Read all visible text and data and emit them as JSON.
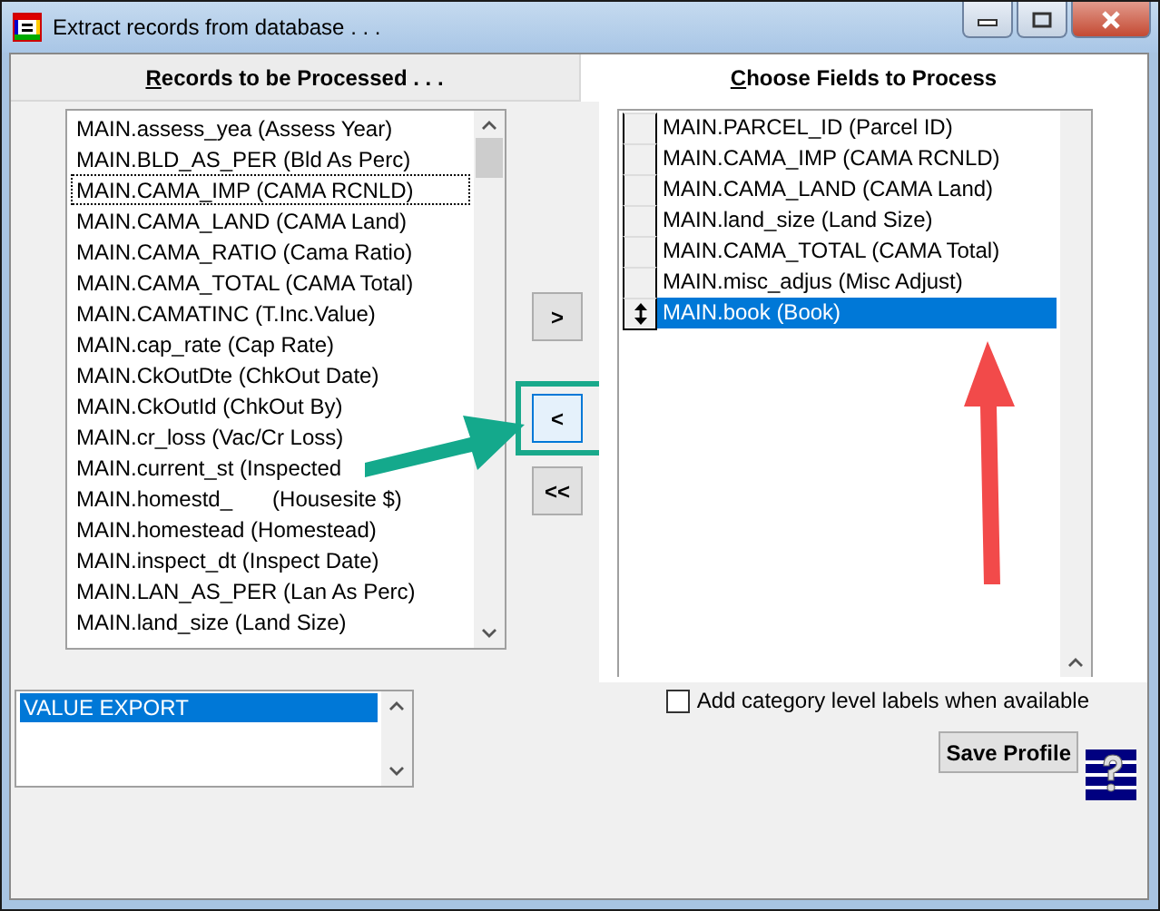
{
  "window": {
    "title": "Extract records from database . . ."
  },
  "tabs": [
    {
      "label": "Records to be Processed . . .",
      "selected": false
    },
    {
      "label": "Choose Fields to Process",
      "selected": true
    }
  ],
  "records": [
    {
      "label": "MAIN.assess_yea (Assess Year)",
      "focused": false
    },
    {
      "label": "MAIN.BLD_AS_PER (Bld As Perc)",
      "focused": false
    },
    {
      "label": "MAIN.CAMA_IMP (CAMA RCNLD)",
      "focused": true
    },
    {
      "label": "MAIN.CAMA_LAND (CAMA Land)",
      "focused": false
    },
    {
      "label": "MAIN.CAMA_RATIO (Cama Ratio)",
      "focused": false
    },
    {
      "label": "MAIN.CAMA_TOTAL (CAMA Total)",
      "focused": false
    },
    {
      "label": "MAIN.CAMATINC (T.Inc.Value)",
      "focused": false
    },
    {
      "label": "MAIN.cap_rate (Cap Rate)",
      "focused": false
    },
    {
      "label": "MAIN.CkOutDte (ChkOut Date)",
      "focused": false
    },
    {
      "label": "MAIN.CkOutId (ChkOut By)",
      "focused": false
    },
    {
      "label": "MAIN.cr_loss (Vac/Cr Loss)",
      "focused": false
    },
    {
      "label": "MAIN.current_st (Inspected",
      "focused": false
    },
    {
      "label": "MAIN.homestd_",
      "label_tail": "(Housesite $)",
      "focused": false
    },
    {
      "label": "MAIN.homestead (Homestead)",
      "focused": false
    },
    {
      "label": "MAIN.inspect_dt (Inspect Date)",
      "focused": false
    },
    {
      "label": "MAIN.LAN_AS_PER (Lan As Perc)",
      "focused": false
    },
    {
      "label": "MAIN.land_size (Land Size)",
      "focused": false
    }
  ],
  "move_buttons": [
    {
      "label": ">",
      "highlighted": false
    },
    {
      "label": "<",
      "highlighted": true
    },
    {
      "label": "<<",
      "highlighted": false
    }
  ],
  "fields": [
    {
      "label": "MAIN.PARCEL_ID (Parcel ID)",
      "selected": false
    },
    {
      "label": "MAIN.CAMA_IMP (CAMA RCNLD)",
      "selected": false
    },
    {
      "label": "MAIN.CAMA_LAND (CAMA Land)",
      "selected": false
    },
    {
      "label": "MAIN.land_size (Land Size)",
      "selected": false
    },
    {
      "label": "MAIN.CAMA_TOTAL (CAMA Total)",
      "selected": false
    },
    {
      "label": "MAIN.misc_adjus (Misc Adjust)",
      "selected": false
    },
    {
      "label": "MAIN.book (Book)",
      "selected": true
    }
  ],
  "profiles": [
    {
      "label": "VALUE EXPORT",
      "selected": true
    }
  ],
  "category_labels": {
    "label": "Add category level labels when available",
    "checked": false
  },
  "save_button": "Save Profile"
}
